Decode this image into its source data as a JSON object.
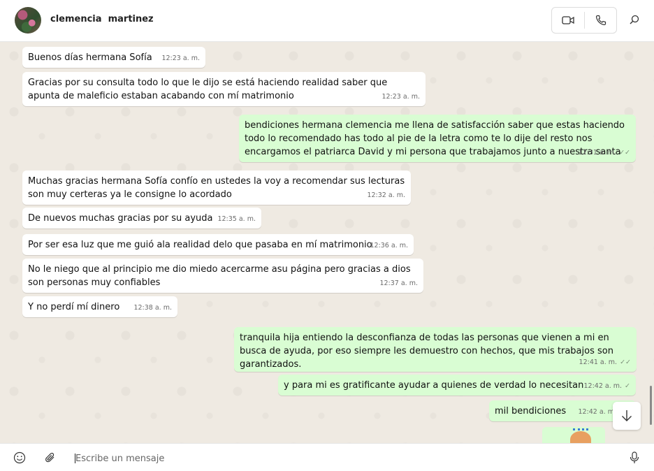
{
  "header": {
    "contact_name": "clemencia  martinez"
  },
  "messages": [
    {
      "text": "Buenos días hermana Sofía",
      "time": "12:23 a. m."
    },
    {
      "text": "Gracias por su consulta todo lo que le dijo se está haciendo realidad saber que apunta de maleficio estaban acabando con mí matrimonio",
      "time": "12:23 a. m."
    },
    {
      "text": "bendiciones hermana clemencia me llena de satisfacción saber que estas haciendo todo lo recomendado has todo al pie de la letra como te lo dije del resto nos encargamos el patriarca David y mi persona que trabajamos junto a nuestra santa",
      "time": "12:31 a. m."
    },
    {
      "text": "Muchas gracias hermana Sofía confío en ustedes la voy a recomendar sus lecturas son muy certeras ya le consigne lo acordado",
      "time": "12:32 a. m."
    },
    {
      "text": "De nuevos muchas gracias por su ayuda",
      "time": "12:35 a. m."
    },
    {
      "text": "Por ser esa luz que me guió ala realidad delo que pasaba en mí matrimonio",
      "time": "12:36 a. m."
    },
    {
      "text": "No le niego que al principio me dio miedo acercarme asu  página pero gracias a dios son personas muy confiables",
      "time": "12:37 a. m."
    },
    {
      "text": "Y no perdí mí dinero",
      "time": "12:38 a. m."
    },
    {
      "text": "tranquila hija entiendo la desconfianza de todas las personas que vienen a mi en busca de ayuda, por eso siempre les demuestro con hechos, que mis trabajos son garantizados.",
      "time": "12:41 a. m."
    },
    {
      "text": "y para mi es gratificante ayudar a quienes de verdad lo necesitan",
      "time": "12:42 a. m."
    },
    {
      "text": "mil bendiciones",
      "time": "12:42 a. m."
    }
  ],
  "composer": {
    "placeholder": "Escribe un mensaje"
  },
  "colors": {
    "incoming": "#ffffff",
    "outgoing": "#d9fdd3",
    "chat_background": "#efeae2"
  },
  "icons": [
    "video-call-icon",
    "phone-icon",
    "search-icon",
    "emoji-icon",
    "attach-icon",
    "microphone-icon",
    "arrow-down-icon",
    "double-check-icon",
    "single-check-icon"
  ]
}
